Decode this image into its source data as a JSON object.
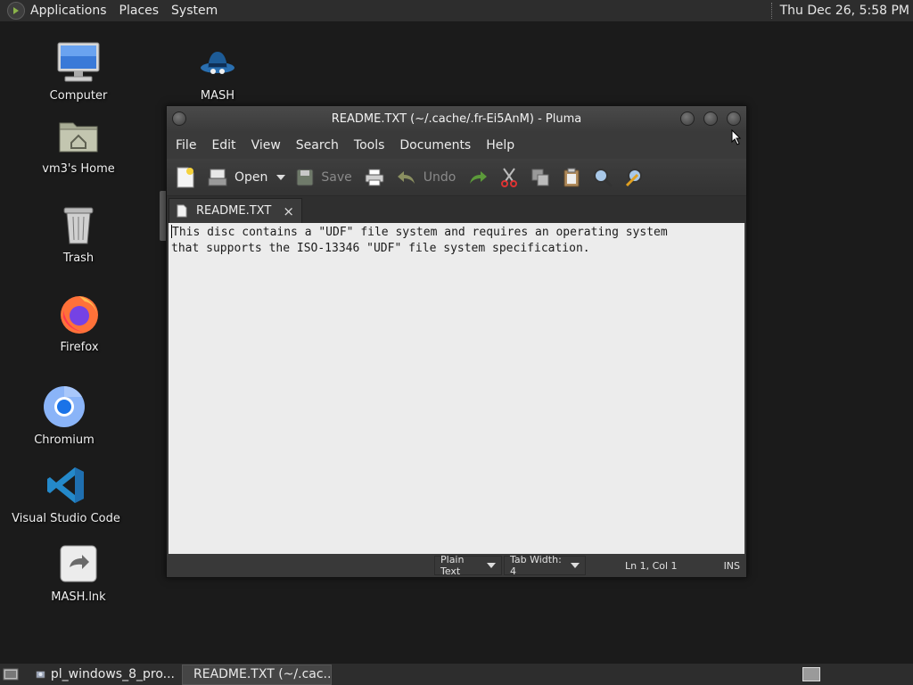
{
  "top_panel": {
    "menus": [
      "Applications",
      "Places",
      "System"
    ],
    "clock": "Thu Dec 26,  5:58 PM"
  },
  "desktop": {
    "icons": [
      {
        "label": "Computer",
        "icon": "computer-icon"
      },
      {
        "label": "MASH",
        "icon": "mash-icon"
      },
      {
        "label": "vm3's Home",
        "icon": "home-folder-icon"
      },
      {
        "label": "Trash",
        "icon": "trash-icon"
      },
      {
        "label": "Firefox",
        "icon": "firefox-icon"
      },
      {
        "label": "Chromium",
        "icon": "chromium-icon"
      },
      {
        "label": "Visual Studio Code",
        "icon": "vscode-icon"
      },
      {
        "label": "MASH.lnk",
        "icon": "shortcut-icon"
      }
    ]
  },
  "window": {
    "title": "README.TXT (~/.cache/.fr-Ei5AnM) - Pluma",
    "menus": [
      "File",
      "Edit",
      "View",
      "Search",
      "Tools",
      "Documents",
      "Help"
    ],
    "toolbar": {
      "open_label": "Open",
      "save_label": "Save",
      "undo_label": "Undo"
    },
    "tab": {
      "label": "README.TXT",
      "close": "×"
    },
    "editor": {
      "lines": [
        "This disc contains a \"UDF\" file system and requires an operating system",
        "that supports the ISO-13346 \"UDF\" file system specification."
      ]
    },
    "statusbar": {
      "language": "Plain Text",
      "tab_width": "Tab Width:  4",
      "position": "Ln 1, Col 1",
      "mode": "INS"
    }
  },
  "taskbar": {
    "items": [
      {
        "label": "pl_windows_8_pro...",
        "icon": "disc-icon",
        "active": false
      },
      {
        "label": "README.TXT (~/.cac...",
        "icon": "text-editor-icon",
        "active": true
      }
    ]
  }
}
